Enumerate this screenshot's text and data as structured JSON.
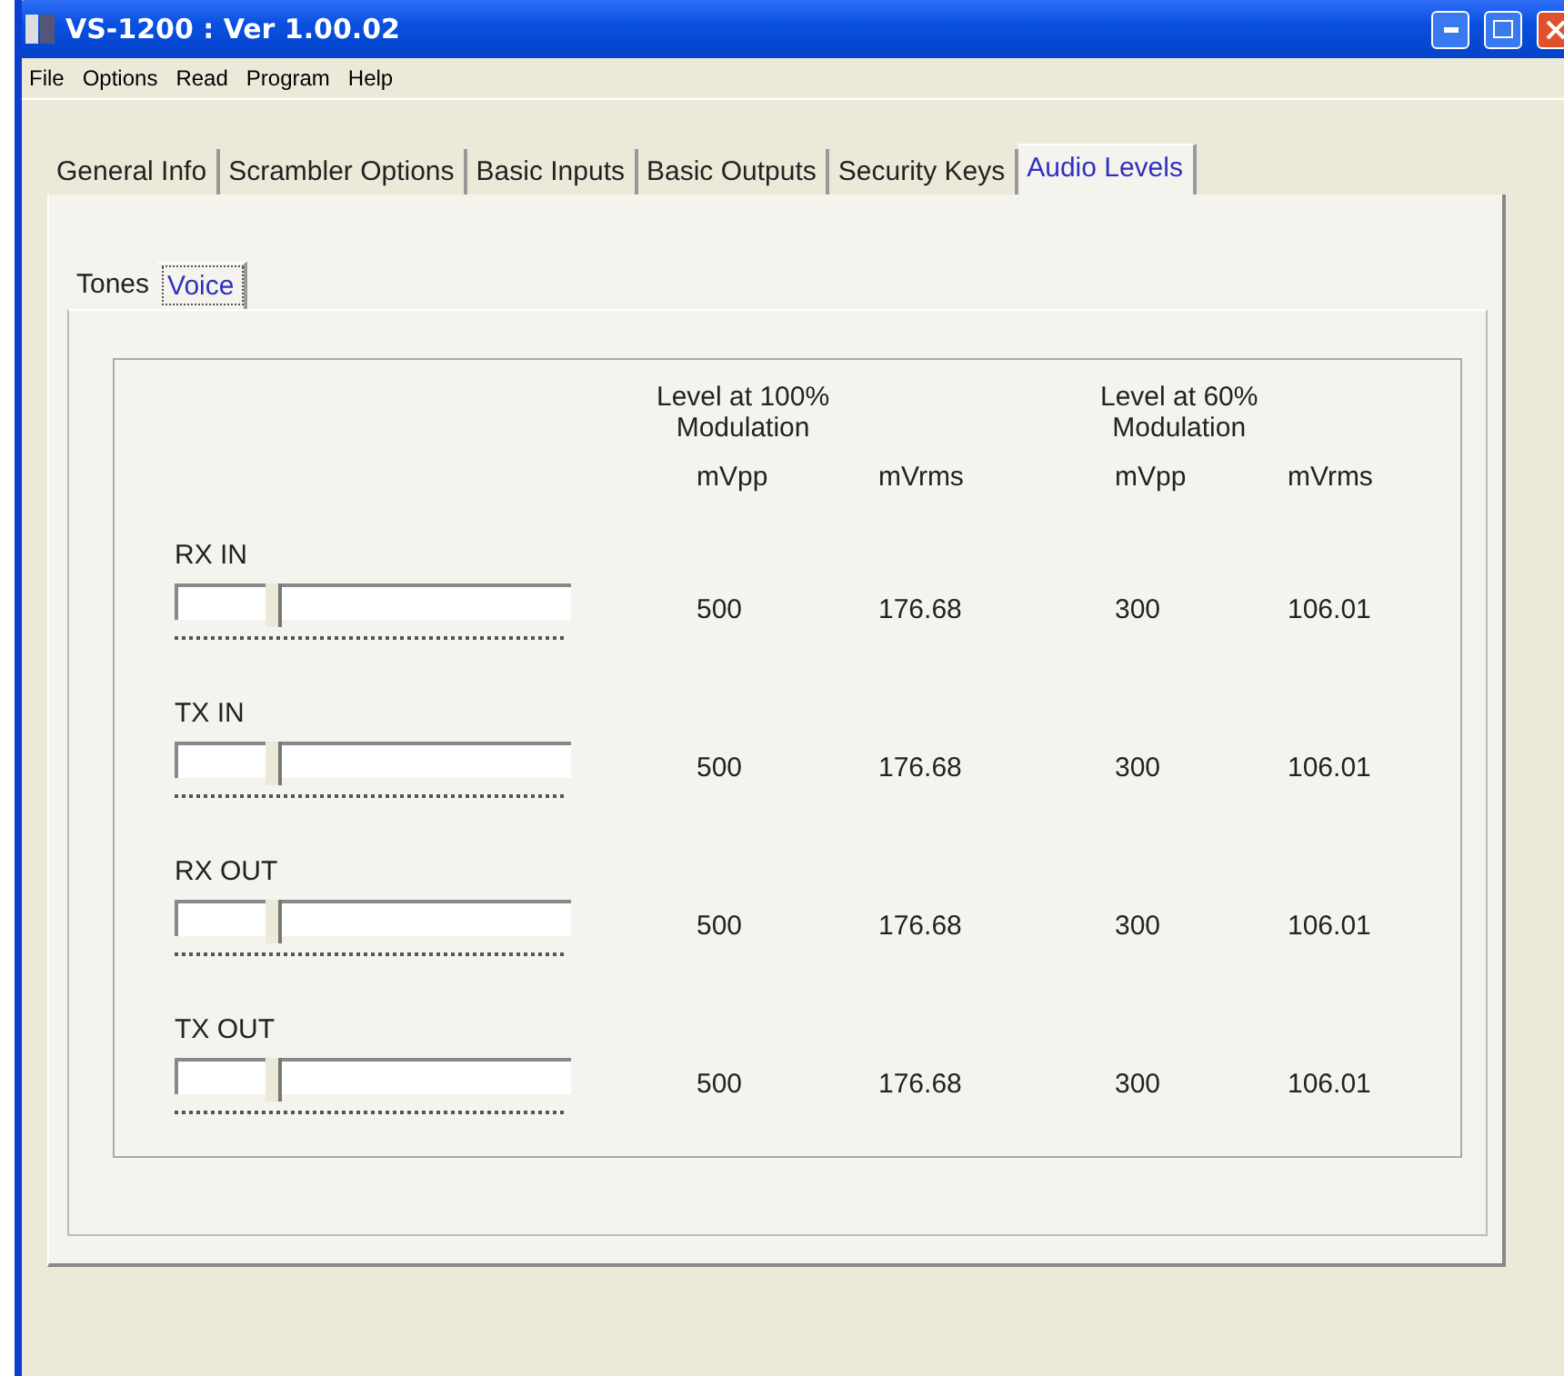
{
  "window": {
    "title": "VS-1200 : Ver 1.00.02"
  },
  "menu": [
    "File",
    "Options",
    "Read",
    "Program",
    "Help"
  ],
  "tabs": [
    {
      "label": "General Info",
      "selected": false
    },
    {
      "label": "Scrambler Options",
      "selected": false
    },
    {
      "label": "Basic Inputs",
      "selected": false
    },
    {
      "label": "Basic Outputs",
      "selected": false
    },
    {
      "label": "Security Keys",
      "selected": false
    },
    {
      "label": "Audio Levels",
      "selected": true
    }
  ],
  "subtabs": [
    {
      "label": "Tones",
      "selected": false
    },
    {
      "label": "Voice",
      "selected": true
    }
  ],
  "headers": {
    "group_100": "Level at 100%\nModulation",
    "group_60": "Level at 60%\nModulation",
    "columns": [
      "mVpp",
      "mVrms",
      "mVpp",
      "mVrms"
    ]
  },
  "channels": [
    {
      "name": "RX IN",
      "level": 0.22,
      "values": [
        "500",
        "176.68",
        "300",
        "106.01"
      ]
    },
    {
      "name": "TX IN",
      "level": 0.22,
      "values": [
        "500",
        "176.68",
        "300",
        "106.01"
      ]
    },
    {
      "name": "RX OUT",
      "level": 0.22,
      "values": [
        "500",
        "176.68",
        "300",
        "106.01"
      ]
    },
    {
      "name": "TX OUT",
      "level": 0.22,
      "values": [
        "500",
        "176.68",
        "300",
        "106.01"
      ]
    }
  ]
}
